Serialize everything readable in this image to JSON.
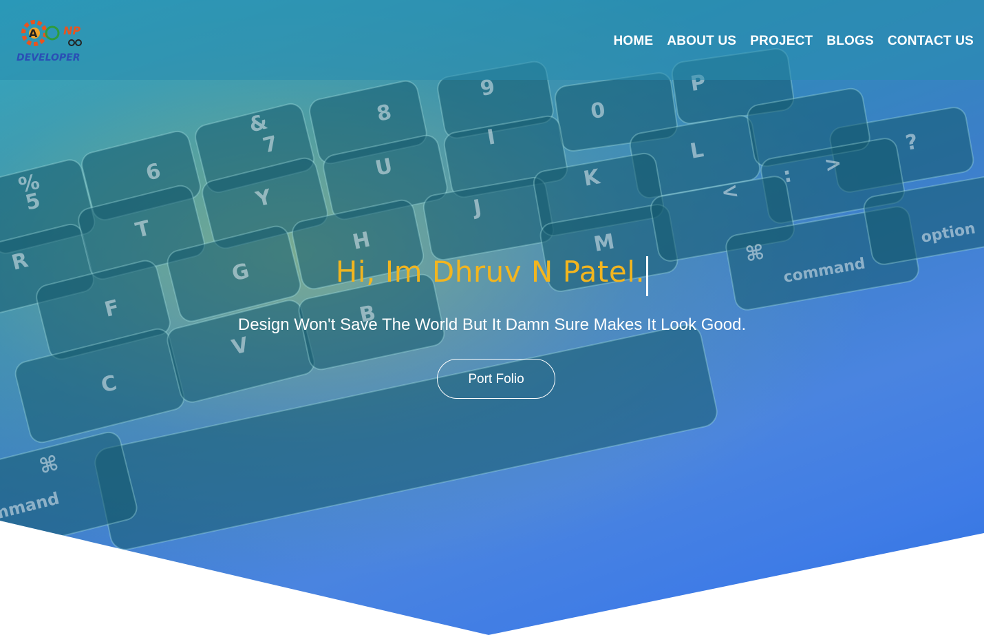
{
  "brand": {
    "logo_text_top": "NP",
    "logo_text_bottom": "DEVELOPER"
  },
  "nav": {
    "items": [
      {
        "label": "HOME"
      },
      {
        "label": "ABOUT US"
      },
      {
        "label": "PROJECT"
      },
      {
        "label": "BLOGS"
      },
      {
        "label": "CONTACT US"
      }
    ]
  },
  "hero": {
    "headline": "Hi, Im Dhruv N Patel.",
    "tagline": "Design Won't Save The World But It Damn Sure Makes It Look Good.",
    "cta_label": "Port Folio"
  },
  "keyboard_keys": [
    "%",
    "5",
    "6",
    "&",
    "7",
    "8",
    "9",
    "0",
    "P",
    "R",
    "T",
    "Y",
    "U",
    "I",
    "?",
    "F",
    "G",
    "H",
    "J",
    "K",
    "L",
    ":",
    ";",
    "C",
    "V",
    "B",
    "M",
    "<",
    ">",
    "⌘",
    "command",
    "option",
    "mmand"
  ],
  "colors": {
    "accent": "#f2b51f",
    "nav_text": "#ffffff",
    "hero_blue": "#3f7ce6",
    "hero_teal": "#2aa7c6"
  }
}
